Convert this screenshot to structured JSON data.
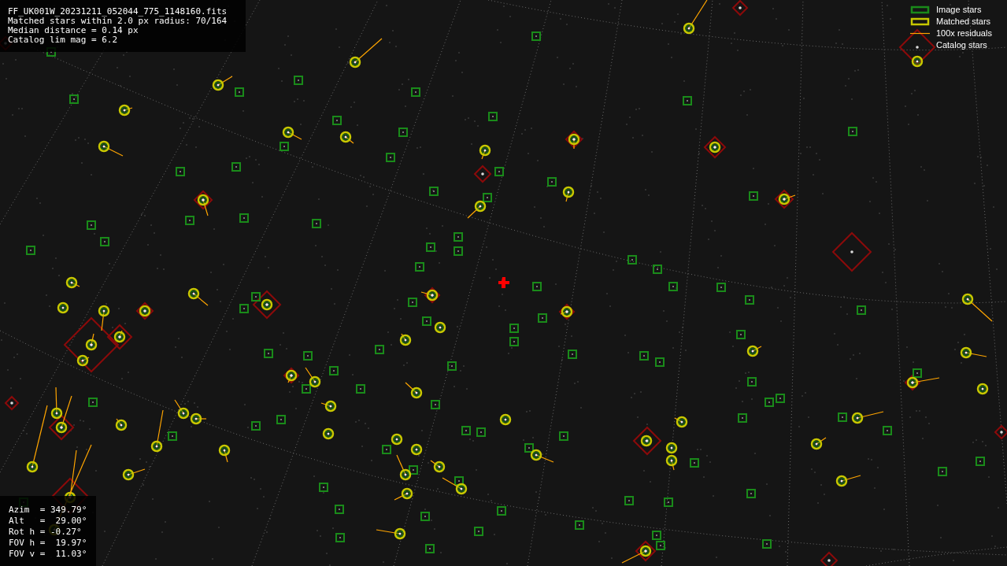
{
  "info_box": {
    "lines": [
      "FF_UK001W_20231211_052044_775_1148160.fits",
      "Matched stars within 2.0 px radius: 70/164",
      "Median distance = 0.14 px",
      "Catalog lim mag = 6.2"
    ]
  },
  "legend": {
    "items": [
      {
        "label": "Image stars",
        "kind": "image"
      },
      {
        "label": "Matched stars",
        "kind": "matched"
      },
      {
        "label": "100x residuals",
        "kind": "residual"
      },
      {
        "label": "Catalog stars",
        "kind": "catalog"
      }
    ]
  },
  "pointing_box": {
    "lines": [
      "Azim  = 349.79°",
      "Alt   =  29.00°",
      "Rot h = -0.27°",
      "FOV h =  19.97°",
      "FOV v =  11.03°"
    ]
  }
}
